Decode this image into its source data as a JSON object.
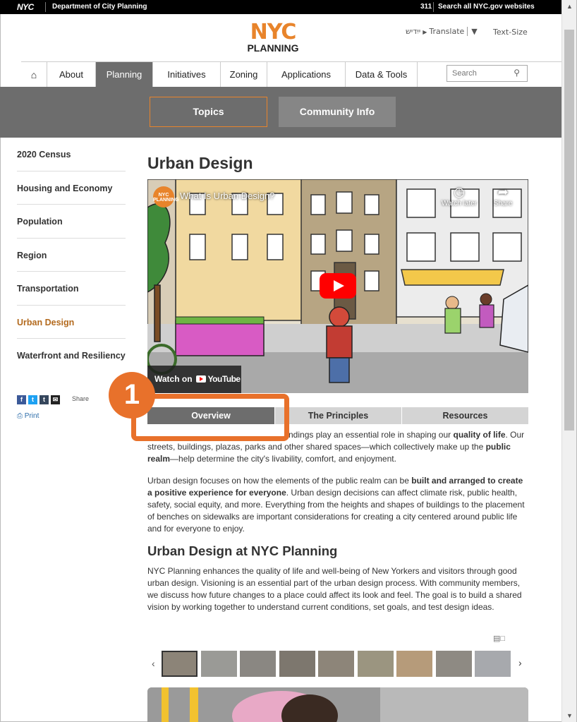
{
  "topbar": {
    "nyc": "NYC",
    "dept": "Department of City Planning",
    "n311": "311",
    "search_all": "Search all NYC.gov websites"
  },
  "header": {
    "logo_nyc": "NYC",
    "logo_planning": "PLANNING",
    "yiddish": "ייִדיש",
    "translate": "Translate",
    "translate_caret": "▼",
    "text_size": "Text-Size"
  },
  "nav": {
    "home_icon": "home-icon",
    "items": [
      "About",
      "Planning",
      "Initiatives",
      "Zoning",
      "Applications",
      "Data & Tools"
    ],
    "active": "Planning",
    "search_placeholder": "Search"
  },
  "subnav": {
    "topics": "Topics",
    "community": "Community Info"
  },
  "sidebar": {
    "items": [
      "2020 Census",
      "Housing and Economy",
      "Population",
      "Region",
      "Transportation",
      "Urban Design",
      "Waterfront and Resiliency"
    ],
    "current": "Urban Design",
    "share_label": "Share",
    "print_label": "Print"
  },
  "main": {
    "title": "Urban Design",
    "video": {
      "title": "What Is Urban Design?",
      "logo_text": "NYC PLANNING",
      "watch_later": "Watch later",
      "share": "Share",
      "watch_on": "Watch on",
      "youtube": "YouTube"
    },
    "tabs": [
      "Overview",
      "The Principles",
      "Resources"
    ],
    "active_tab": "Overview",
    "callout_number": "1",
    "p1": {
      "a": "ndings play an essential role in shaping our ",
      "b": "quality of life",
      "c": ". Our streets, buildings, plazas, parks and other shared spaces—which collectively make up the ",
      "d": "public realm",
      "e": "—help determine the city's livability, comfort, and enjoyment."
    },
    "p2": {
      "a": "Urban design focuses on how the elements of the public realm can be ",
      "b": "built and arranged to create a positive experience for everyone",
      "c": ". Urban design decisions can affect climate risk, public health, safety, social equity, and more. Everything from the heights and shapes of buildings to the placement of benches on sidewalks are important considerations for creating a city centered around public life and for everyone to enjoy."
    },
    "subtitle": "Urban Design at NYC Planning",
    "p3": "NYC Planning enhances the quality of life and well-being of New Yorkers and visitors through good urban design. Visioning is an essential part of the urban design process. With community members, we discuss how future changes to a place could affect its look and feel. The goal is to build a shared vision by working together to understand current conditions, set goals, and test design ideas.",
    "gallery": {
      "prev": "‹",
      "next": "›",
      "thumb_count": 9,
      "thumb_colors": [
        "#8c8478",
        "#9a9a96",
        "#8a8782",
        "#7d776e",
        "#8d8579",
        "#9b9580",
        "#b69b7a",
        "#8e8a83",
        "#a7a9ad"
      ]
    }
  },
  "colors": {
    "accent": "#e8842b",
    "callout": "#e8712b",
    "nav_active": "#6d6d6d",
    "link": "#2a6ba8"
  }
}
